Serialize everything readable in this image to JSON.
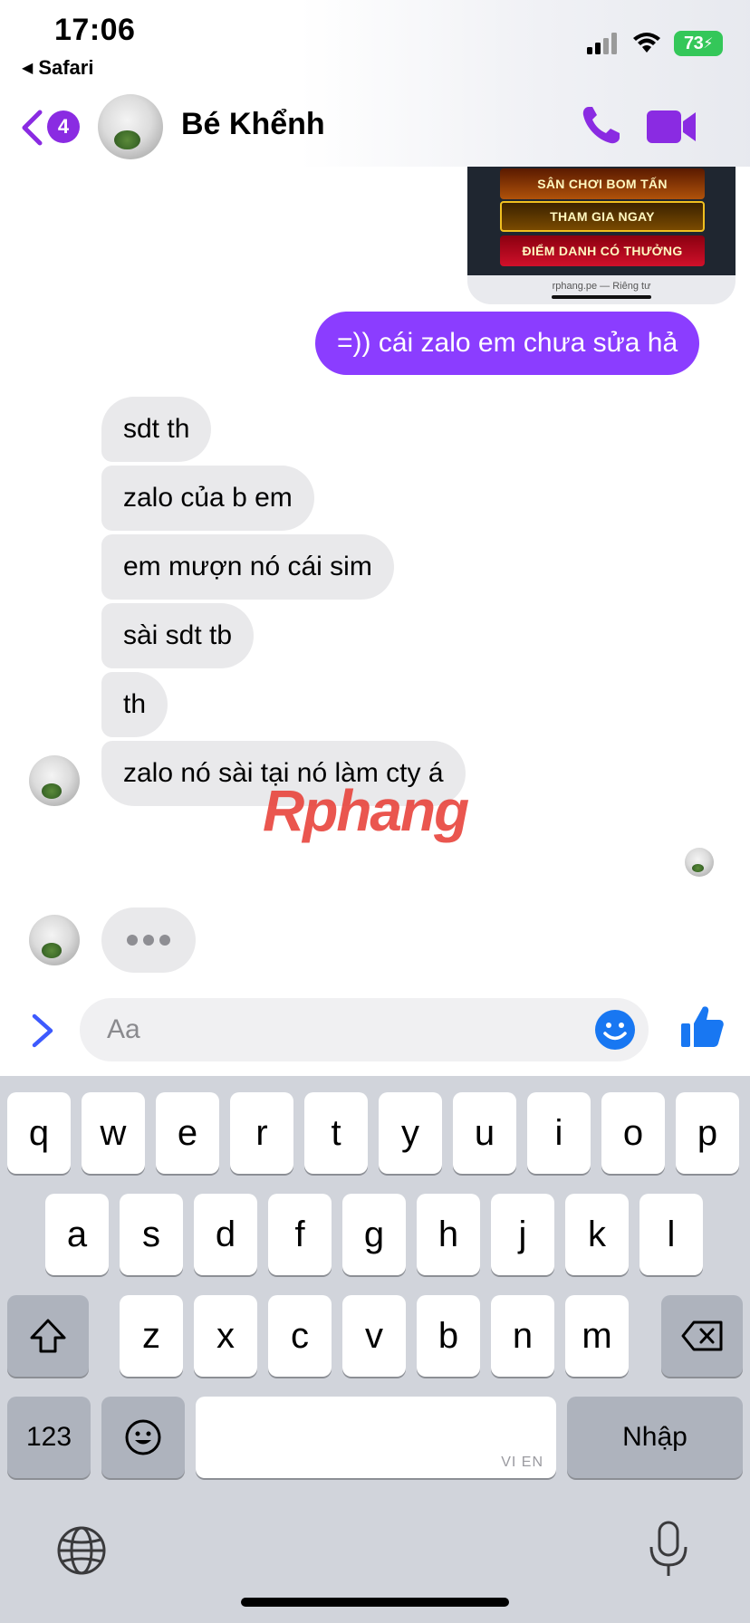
{
  "status_bar": {
    "time": "17:06",
    "back_app": "Safari",
    "battery": "73"
  },
  "header": {
    "unread_count": "4",
    "contact_name": "Bé Khểnh"
  },
  "shared_image": {
    "banners": [
      "SÂN CHƠI BOM TẤN",
      "THAM GIA NGAY",
      "ĐIỂM DANH CÓ THƯỞNG"
    ],
    "url": "rphang.pe — Riêng tư"
  },
  "messages": {
    "outgoing": "=)) cái zalo em chưa sửa hả",
    "incoming": [
      "sdt th",
      "zalo của b em",
      "em mượn nó cái sim",
      "sài sdt tb",
      "th",
      "zalo nó sài tại nó làm cty á"
    ]
  },
  "watermark": {
    "red": "Rphang",
    "blue": ""
  },
  "composer": {
    "placeholder": "Aa"
  },
  "keyboard": {
    "row1": [
      "q",
      "w",
      "e",
      "r",
      "t",
      "y",
      "u",
      "i",
      "o",
      "p"
    ],
    "row2": [
      "a",
      "s",
      "d",
      "f",
      "g",
      "h",
      "j",
      "k",
      "l"
    ],
    "row3": [
      "z",
      "x",
      "c",
      "v",
      "b",
      "n",
      "m"
    ],
    "numbers_label": "123",
    "return_label": "Nhập",
    "lang_hint": "VI EN"
  },
  "colors": {
    "accent": "#8b3dff",
    "incoming_bubble": "#e9e9eb",
    "like_blue": "#1877f2"
  }
}
